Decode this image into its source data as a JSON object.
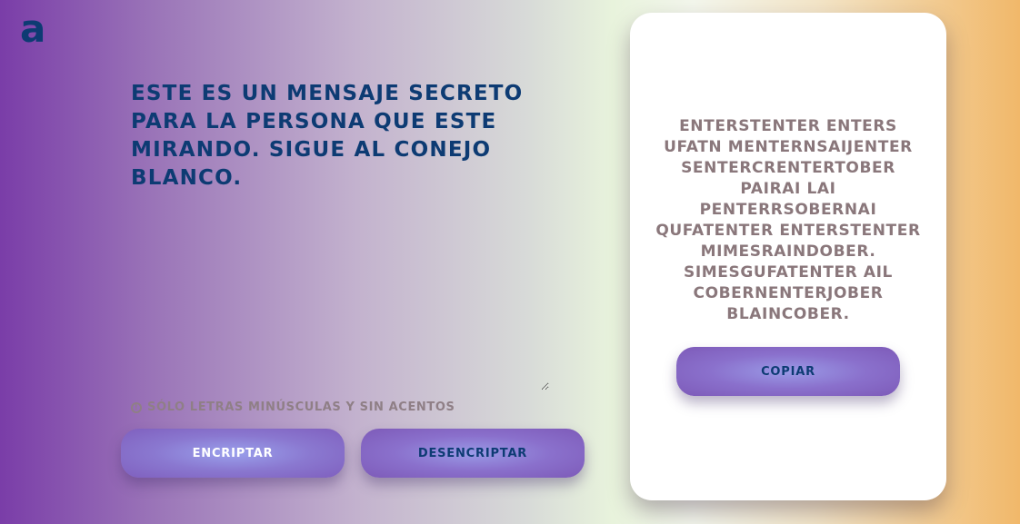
{
  "logo": {
    "text": "a",
    "icon": "alura-logo-icon",
    "color": "#0d3b73"
  },
  "input": {
    "value": "Este es un mensaje secreto para la persona que este mirando. Sigue al conejo blanco.",
    "placeholder": ""
  },
  "hint": {
    "icon": "info-icon",
    "text": "Sólo letras minúsculas y sin acentos"
  },
  "buttons": {
    "encrypt_label": "Encriptar",
    "decrypt_label": "Desencriptar",
    "copy_label": "Copiar"
  },
  "output": {
    "text": "enterstenter enters ufatn menternsaijenter sentercrentertober pairai lai penterrsobernai qufatenter enterstenter mimesraindober. simesgufatenter ail cobernenterjober blaincober."
  },
  "colors": {
    "primary_text": "#0d3b73",
    "hint_text": "#8f7f86",
    "output_text": "#8a777b",
    "card_bg": "#ffffff"
  }
}
